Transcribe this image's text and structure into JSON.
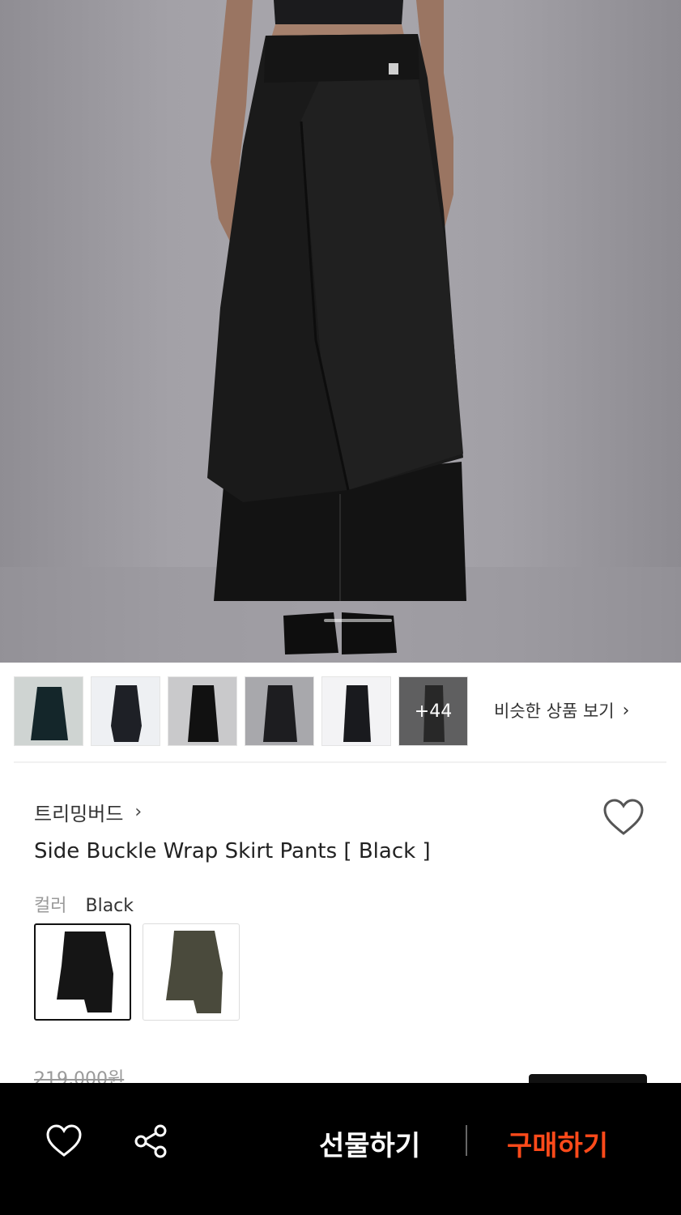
{
  "product": {
    "brand": "트리밍버드",
    "title": "Side Buckle Wrap Skirt Pants [ Black ]",
    "option_label": "컬러",
    "option_value": "Black",
    "original_price": "219,000원"
  },
  "gallery": {
    "more_count": "+44",
    "similar_label": "비슷한 상품 보기",
    "chevron": "›"
  },
  "brand_chevron": "›",
  "bottom_bar": {
    "gift_label": "선물하기",
    "buy_label": "구매하기"
  },
  "colors": {
    "accent_buy": "#ff4a1a",
    "bar_background": "#000000",
    "garment_black": "#151515",
    "garment_olive": "#4a4a3c"
  },
  "icons": {
    "wish": "heart-outline-icon",
    "share": "share-icon",
    "chevron": "chevron-right-icon"
  }
}
